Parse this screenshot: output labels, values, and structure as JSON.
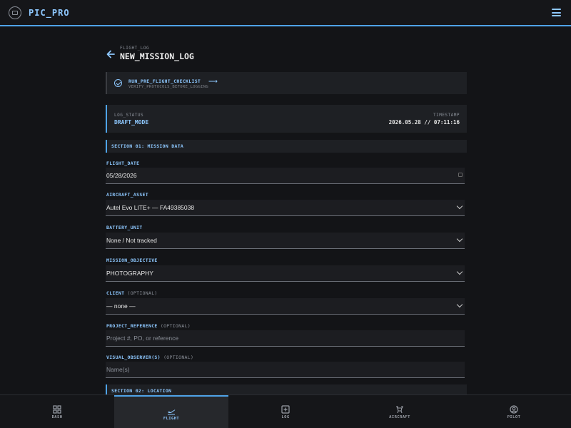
{
  "app": {
    "title": "PIC_PRO",
    "logo_icon": "shield-drone-logo-icon",
    "menu_icon": "hamburger-menu-icon"
  },
  "page": {
    "breadcrumb": "FLIGHT_LOG",
    "title": "NEW_MISSION_LOG"
  },
  "checklist": {
    "title": "RUN_PRE_FLIGHT_CHECKLIST",
    "arrow": "⟶",
    "subtitle": "VERIFY_PROTOCOLS_BEFORE_LOGGING"
  },
  "status": {
    "label": "LOG_STATUS",
    "value": "DRAFT_MODE",
    "timestamp_label": "TIMESTAMP",
    "timestamp_value": "2026.05.28 // 07:11:16"
  },
  "sections": {
    "s1": "SECTION 01: MISSION DATA",
    "s2": "SECTION 02: LOCATION"
  },
  "fields": {
    "flight_date": {
      "label": "FLIGHT_DATE",
      "value": "05/28/2026"
    },
    "aircraft": {
      "label": "AIRCRAFT_ASSET",
      "value": "Autel Evo LITE+ — FA49385038"
    },
    "battery": {
      "label": "BATTERY_UNIT",
      "value": "None / Not tracked"
    },
    "objective": {
      "label": "MISSION_OBJECTIVE",
      "value": "PHOTOGRAPHY"
    },
    "client": {
      "label": "CLIENT",
      "optional": "(OPTIONAL)",
      "value": "— none —"
    },
    "project_ref": {
      "label": "PROJECT_REFERENCE",
      "optional": "(OPTIONAL)",
      "placeholder": "Project #, PO, or reference"
    },
    "observers": {
      "label": "VISUAL_OBSERVER(S)",
      "optional": "(OPTIONAL)",
      "placeholder": "Name(s)"
    }
  },
  "nav": {
    "items": [
      {
        "label": "DASH",
        "icon": "grid-icon"
      },
      {
        "label": "FLIGHT",
        "icon": "plane-takeoff-icon"
      },
      {
        "label": "LOG",
        "icon": "plus-square-icon"
      },
      {
        "label": "AIRCRAFT",
        "icon": "drone-icon"
      },
      {
        "label": "PILOT",
        "icon": "user-circle-icon"
      }
    ],
    "active": "FLIGHT"
  },
  "colors": {
    "accent": "#4fa3e8",
    "accent_text": "#8ec8ff",
    "background": "#131417",
    "panel": "#1e2024"
  }
}
